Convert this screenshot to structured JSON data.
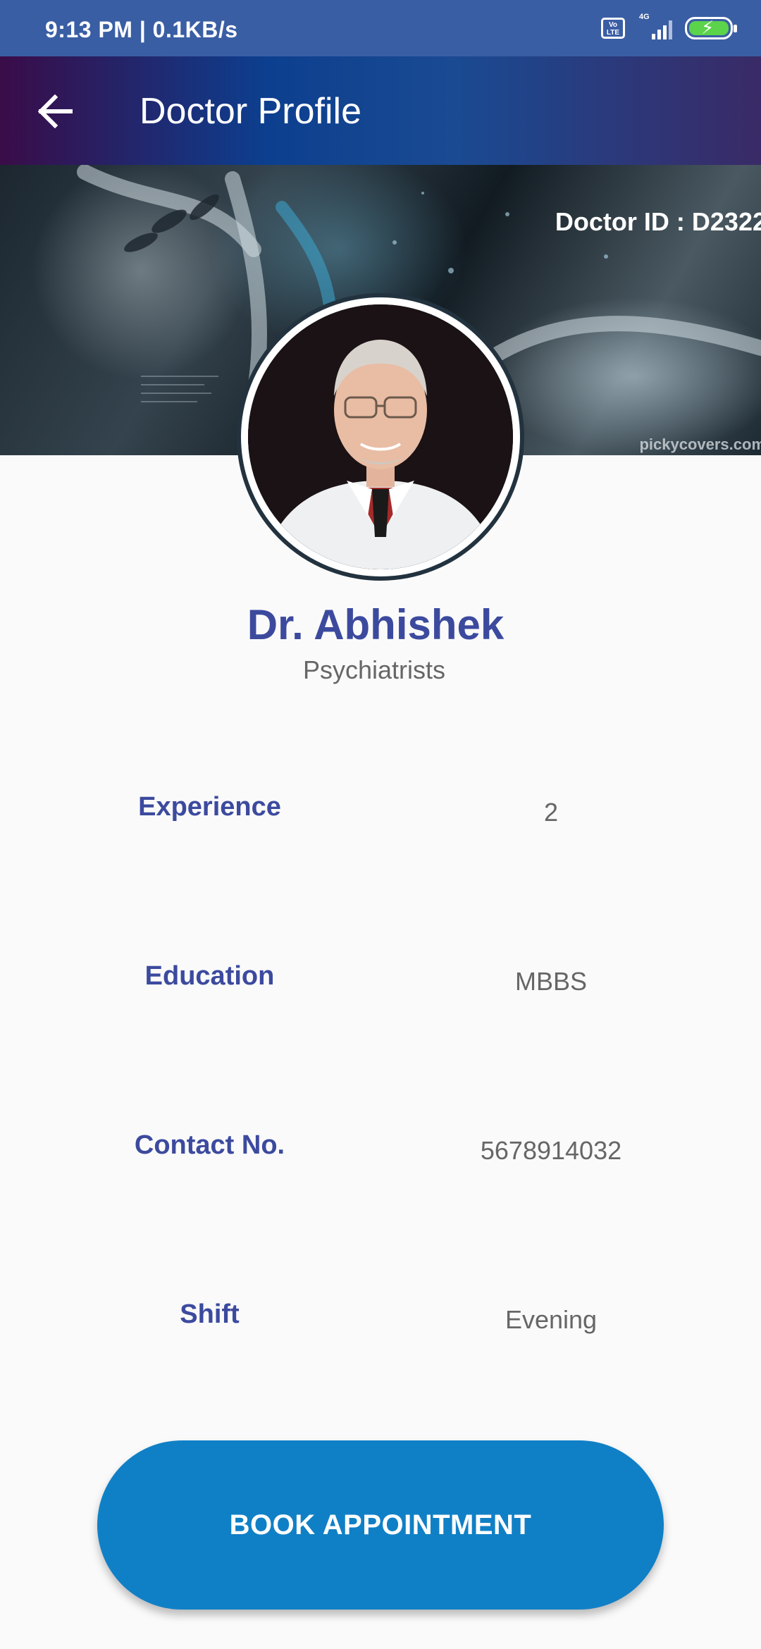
{
  "status_bar": {
    "time": "9:13 PM | 0.1KB/s",
    "volte_label": "Vo\nLTE",
    "network_label": "4G",
    "icons": [
      "volte-icon",
      "signal-icon",
      "battery-charging-icon"
    ]
  },
  "app_bar": {
    "title": "Doctor Profile",
    "back_icon": "arrow-left-icon"
  },
  "banner": {
    "doctor_id": "Doctor ID : D2322",
    "watermark": "pickycovers.com"
  },
  "profile": {
    "name": "Dr. Abhishek",
    "specialty": "Psychiatrists"
  },
  "details": {
    "experience_label": "Experience",
    "experience_value": "2",
    "education_label": "Education",
    "education_value": "MBBS",
    "contact_label": "Contact No.",
    "contact_value": "5678914032",
    "shift_label": "Shift",
    "shift_value": "Evening"
  },
  "actions": {
    "book_label": "BOOK APPOINTMENT"
  },
  "colors": {
    "status_bar": "#3a5ea4",
    "accent_text": "#3c4a9e",
    "button": "#1080c6",
    "battery_fill": "#5bd34a"
  }
}
